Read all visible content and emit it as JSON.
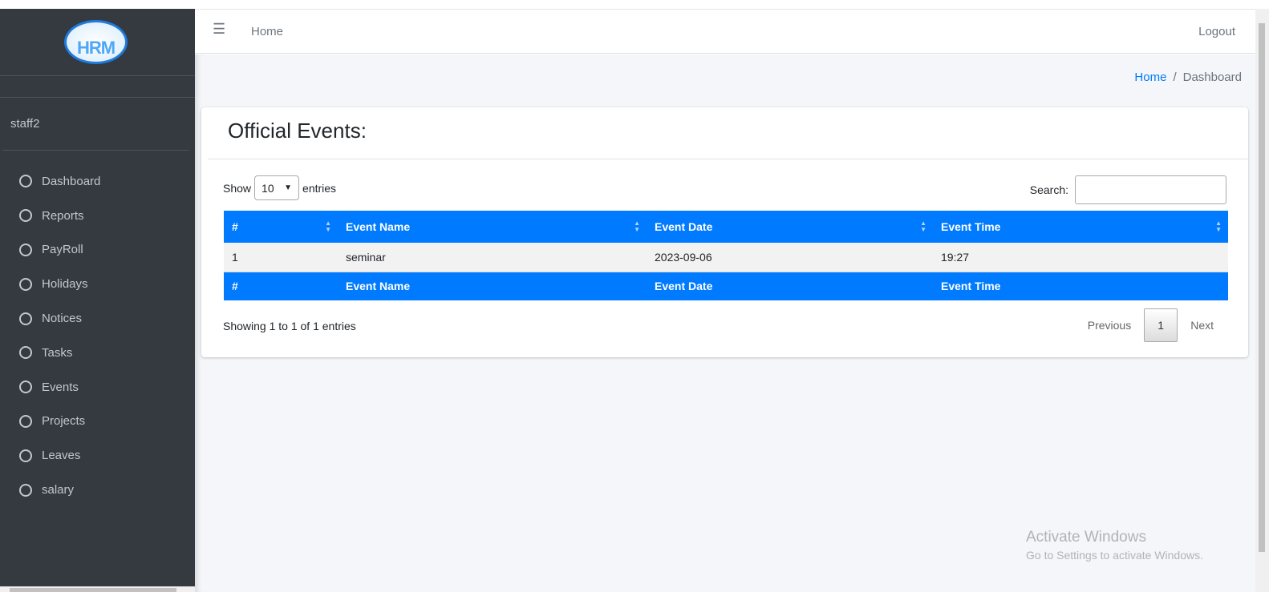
{
  "sidebar": {
    "logo_text": "HRM",
    "user": "staff2",
    "items": [
      {
        "label": "Dashboard"
      },
      {
        "label": "Reports"
      },
      {
        "label": "PayRoll"
      },
      {
        "label": "Holidays"
      },
      {
        "label": "Notices"
      },
      {
        "label": "Tasks"
      },
      {
        "label": "Events"
      },
      {
        "label": "Projects"
      },
      {
        "label": "Leaves"
      },
      {
        "label": "salary"
      }
    ]
  },
  "topbar": {
    "menu_icon": "hamburger-icon",
    "home": "Home",
    "logout": "Logout"
  },
  "breadcrumb": {
    "home": "Home",
    "sep": "/",
    "current": "Dashboard"
  },
  "card": {
    "title": "Official Events:",
    "show": "Show",
    "entries_value": "10",
    "entries": "entries",
    "search_label": "Search:",
    "search_value": "",
    "columns": [
      "#",
      "Event Name",
      "Event Date",
      "Event Time"
    ],
    "rows": [
      [
        "1",
        "seminar",
        "2023-09-06",
        "19:27"
      ]
    ],
    "info": "Showing 1 to 1 of 1 entries",
    "previous": "Previous",
    "page": "1",
    "next": "Next"
  },
  "watermark": {
    "line1": "Activate Windows",
    "line2": "Go to Settings to activate Windows."
  },
  "colors": {
    "sidebar": "#343a40",
    "header": "#007bff",
    "link": "#007bff"
  }
}
